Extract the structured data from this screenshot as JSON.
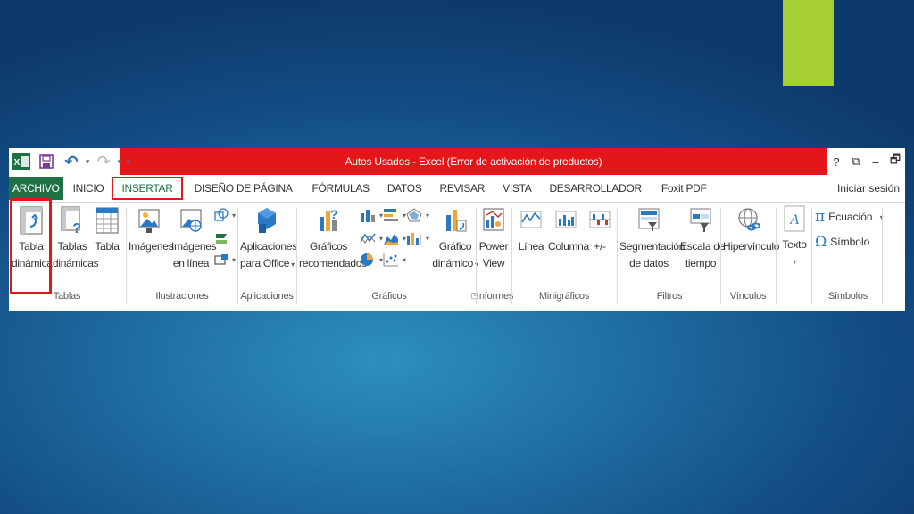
{
  "window": {
    "title": "Autos Usados -  Excel (Error de activación de productos)"
  },
  "qat": {
    "undo": "↶",
    "redo": "↷",
    "caret": "▾"
  },
  "controls": {
    "help": "?",
    "restore": "⧉",
    "minimize": "–",
    "maximize": "🗗"
  },
  "tabs": [
    {
      "label": "ARCHIVO"
    },
    {
      "label": "INICIO"
    },
    {
      "label": "INSERTAR"
    },
    {
      "label": "DISEÑO DE PÁGINA"
    },
    {
      "label": "FÓRMULAS"
    },
    {
      "label": "DATOS"
    },
    {
      "label": "REVISAR"
    },
    {
      "label": "VISTA"
    },
    {
      "label": "DESARROLLADOR"
    },
    {
      "label": "Foxit PDF"
    }
  ],
  "signin": "Iniciar sesión",
  "groups": {
    "tablas": {
      "label": "Tablas",
      "tabla_dinamica": [
        "Tabla",
        "dinámica"
      ],
      "tablas_dinamicas": [
        "Tablas",
        "dinámicas"
      ],
      "tabla": "Tabla"
    },
    "ilustraciones": {
      "label": "Ilustraciones",
      "imagenes": "Imágenes",
      "imagenes_linea": [
        "Imágenes",
        "en línea"
      ]
    },
    "aplicaciones": {
      "label": "Aplicaciones",
      "apps": [
        "Aplicaciones",
        "para Office"
      ]
    },
    "graficos": {
      "label": "Gráficos",
      "recomendados": [
        "Gráficos",
        "recomendados"
      ],
      "dinamico": [
        "Gráfico",
        "dinámico"
      ]
    },
    "informes": {
      "label": "Informes",
      "power_view": [
        "Power",
        "View"
      ]
    },
    "minigraficos": {
      "label": "Minigráficos",
      "linea": "Línea",
      "columna": "Columna",
      "ganancia": "+/-"
    },
    "filtros": {
      "label": "Filtros",
      "segmentacion": [
        "Segmentación",
        "de datos"
      ],
      "escala": [
        "Escala de",
        "tiempo"
      ]
    },
    "vinculos": {
      "label": "Vínculos",
      "hipervinculo": "Hipervínculo"
    },
    "texto": {
      "texto": "Texto"
    },
    "simbolos": {
      "label": "Símbolos",
      "ecuacion": "Ecuación",
      "simbolo": "Símbolo",
      "pi": "π",
      "omega": "Ω"
    }
  },
  "colors": {
    "title_red": "#e5161a",
    "excel_green": "#1e7145",
    "accent_green": "#a6cf35",
    "bg_blue": "#1f6ea4"
  }
}
